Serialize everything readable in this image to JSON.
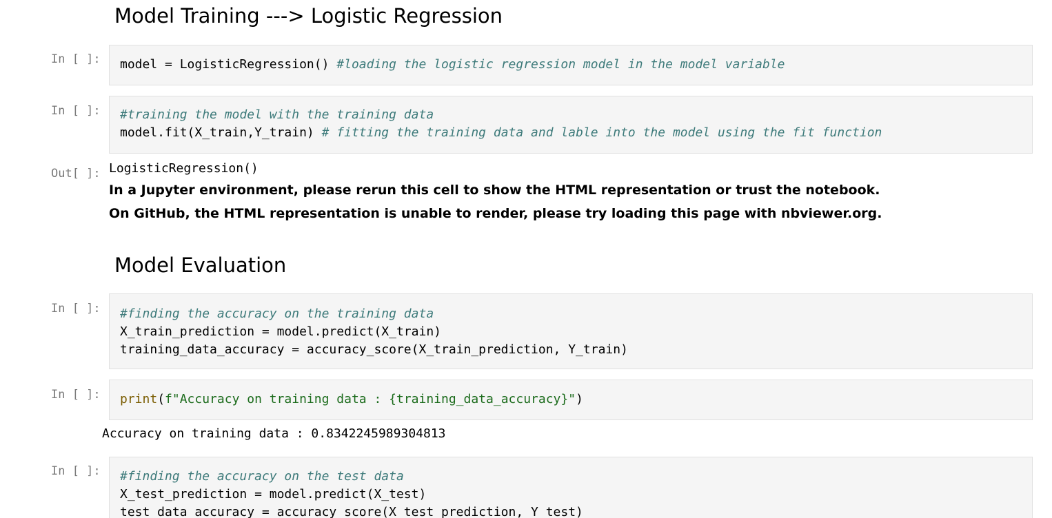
{
  "sections": [
    {
      "heading": "Model Training ---> Logistic Regression"
    },
    {
      "heading": "Model Evaluation"
    }
  ],
  "cells": [
    {
      "prompt": "In [ ]:",
      "lines": [
        [
          {
            "t": "model = LogisticRegression() ",
            "c": ""
          },
          {
            "t": "#loading the logistic regression model in the model variable",
            "c": "cm"
          }
        ]
      ]
    },
    {
      "prompt": "In [ ]:",
      "lines": [
        [
          {
            "t": "#training the model with the training data",
            "c": "cm"
          }
        ],
        [
          {
            "t": "model.fit(X_train,Y_train) ",
            "c": ""
          },
          {
            "t": "# fitting the training data and lable into the model using the fit function",
            "c": "cm"
          }
        ]
      ]
    },
    {
      "prompt": "In [ ]:",
      "lines": [
        [
          {
            "t": "#finding the accuracy on the training data",
            "c": "cm"
          }
        ],
        [
          {
            "t": "X_train_prediction = model.predict(X_train)",
            "c": ""
          }
        ],
        [
          {
            "t": "training_data_accuracy = accuracy_score(X_train_prediction, Y_train)",
            "c": ""
          }
        ]
      ]
    },
    {
      "prompt": "In [ ]:",
      "lines": [
        [
          {
            "t": "print",
            "c": "kw"
          },
          {
            "t": "(",
            "c": ""
          },
          {
            "t": "f\"Accuracy on training data : {training_data_accuracy}\"",
            "c": "st"
          },
          {
            "t": ")",
            "c": ""
          }
        ]
      ]
    },
    {
      "prompt": "In [ ]:",
      "lines": [
        [
          {
            "t": "#finding the accuracy on the test data",
            "c": "cm"
          }
        ],
        [
          {
            "t": "X_test_prediction = model.predict(X_test)",
            "c": ""
          }
        ],
        [
          {
            "t": "test_data_accuracy = accuracy_score(X_test_prediction, Y_test)",
            "c": ""
          }
        ]
      ]
    }
  ],
  "outputs": {
    "fit": {
      "prompt": "Out[ ]:",
      "repr": "LogisticRegression()",
      "notice1": "In a Jupyter environment, please rerun this cell to show the HTML representation or trust the notebook.",
      "notice2": "On GitHub, the HTML representation is unable to render, please try loading this page with nbviewer.org."
    },
    "accuracy_train": "Accuracy on training data : 0.8342245989304813"
  },
  "colors": {
    "comment": "#3d7a7a",
    "keyword": "#7a5c00",
    "string": "#1b6b1b",
    "prompt": "#7a7a7a",
    "cell_bg": "#f5f5f5"
  }
}
